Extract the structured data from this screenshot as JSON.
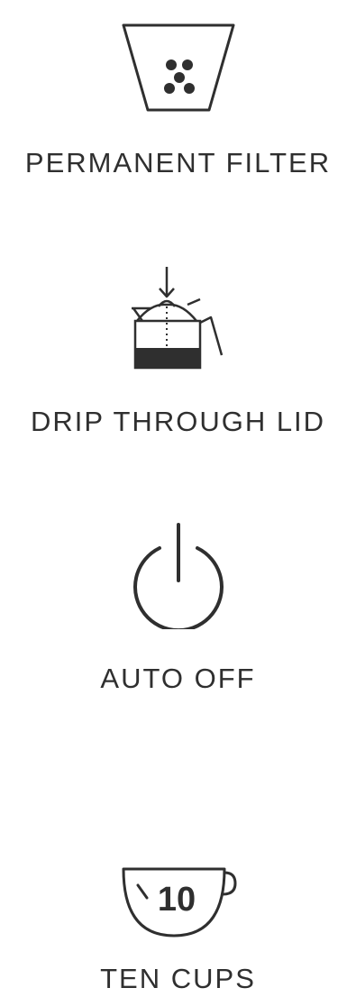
{
  "colors": {
    "ink": "#2f2f2f",
    "background": "#ffffff"
  },
  "features": [
    {
      "icon": "filter-basket-icon",
      "label": "PERMANENT FILTER"
    },
    {
      "icon": "carafe-drip-lid-icon",
      "label": "DRIP THROUGH LID"
    },
    {
      "icon": "power-icon",
      "label": "AUTO OFF"
    },
    {
      "icon": "ten-cup-icon",
      "label": "TEN CUPS",
      "cup_number": "10"
    }
  ]
}
